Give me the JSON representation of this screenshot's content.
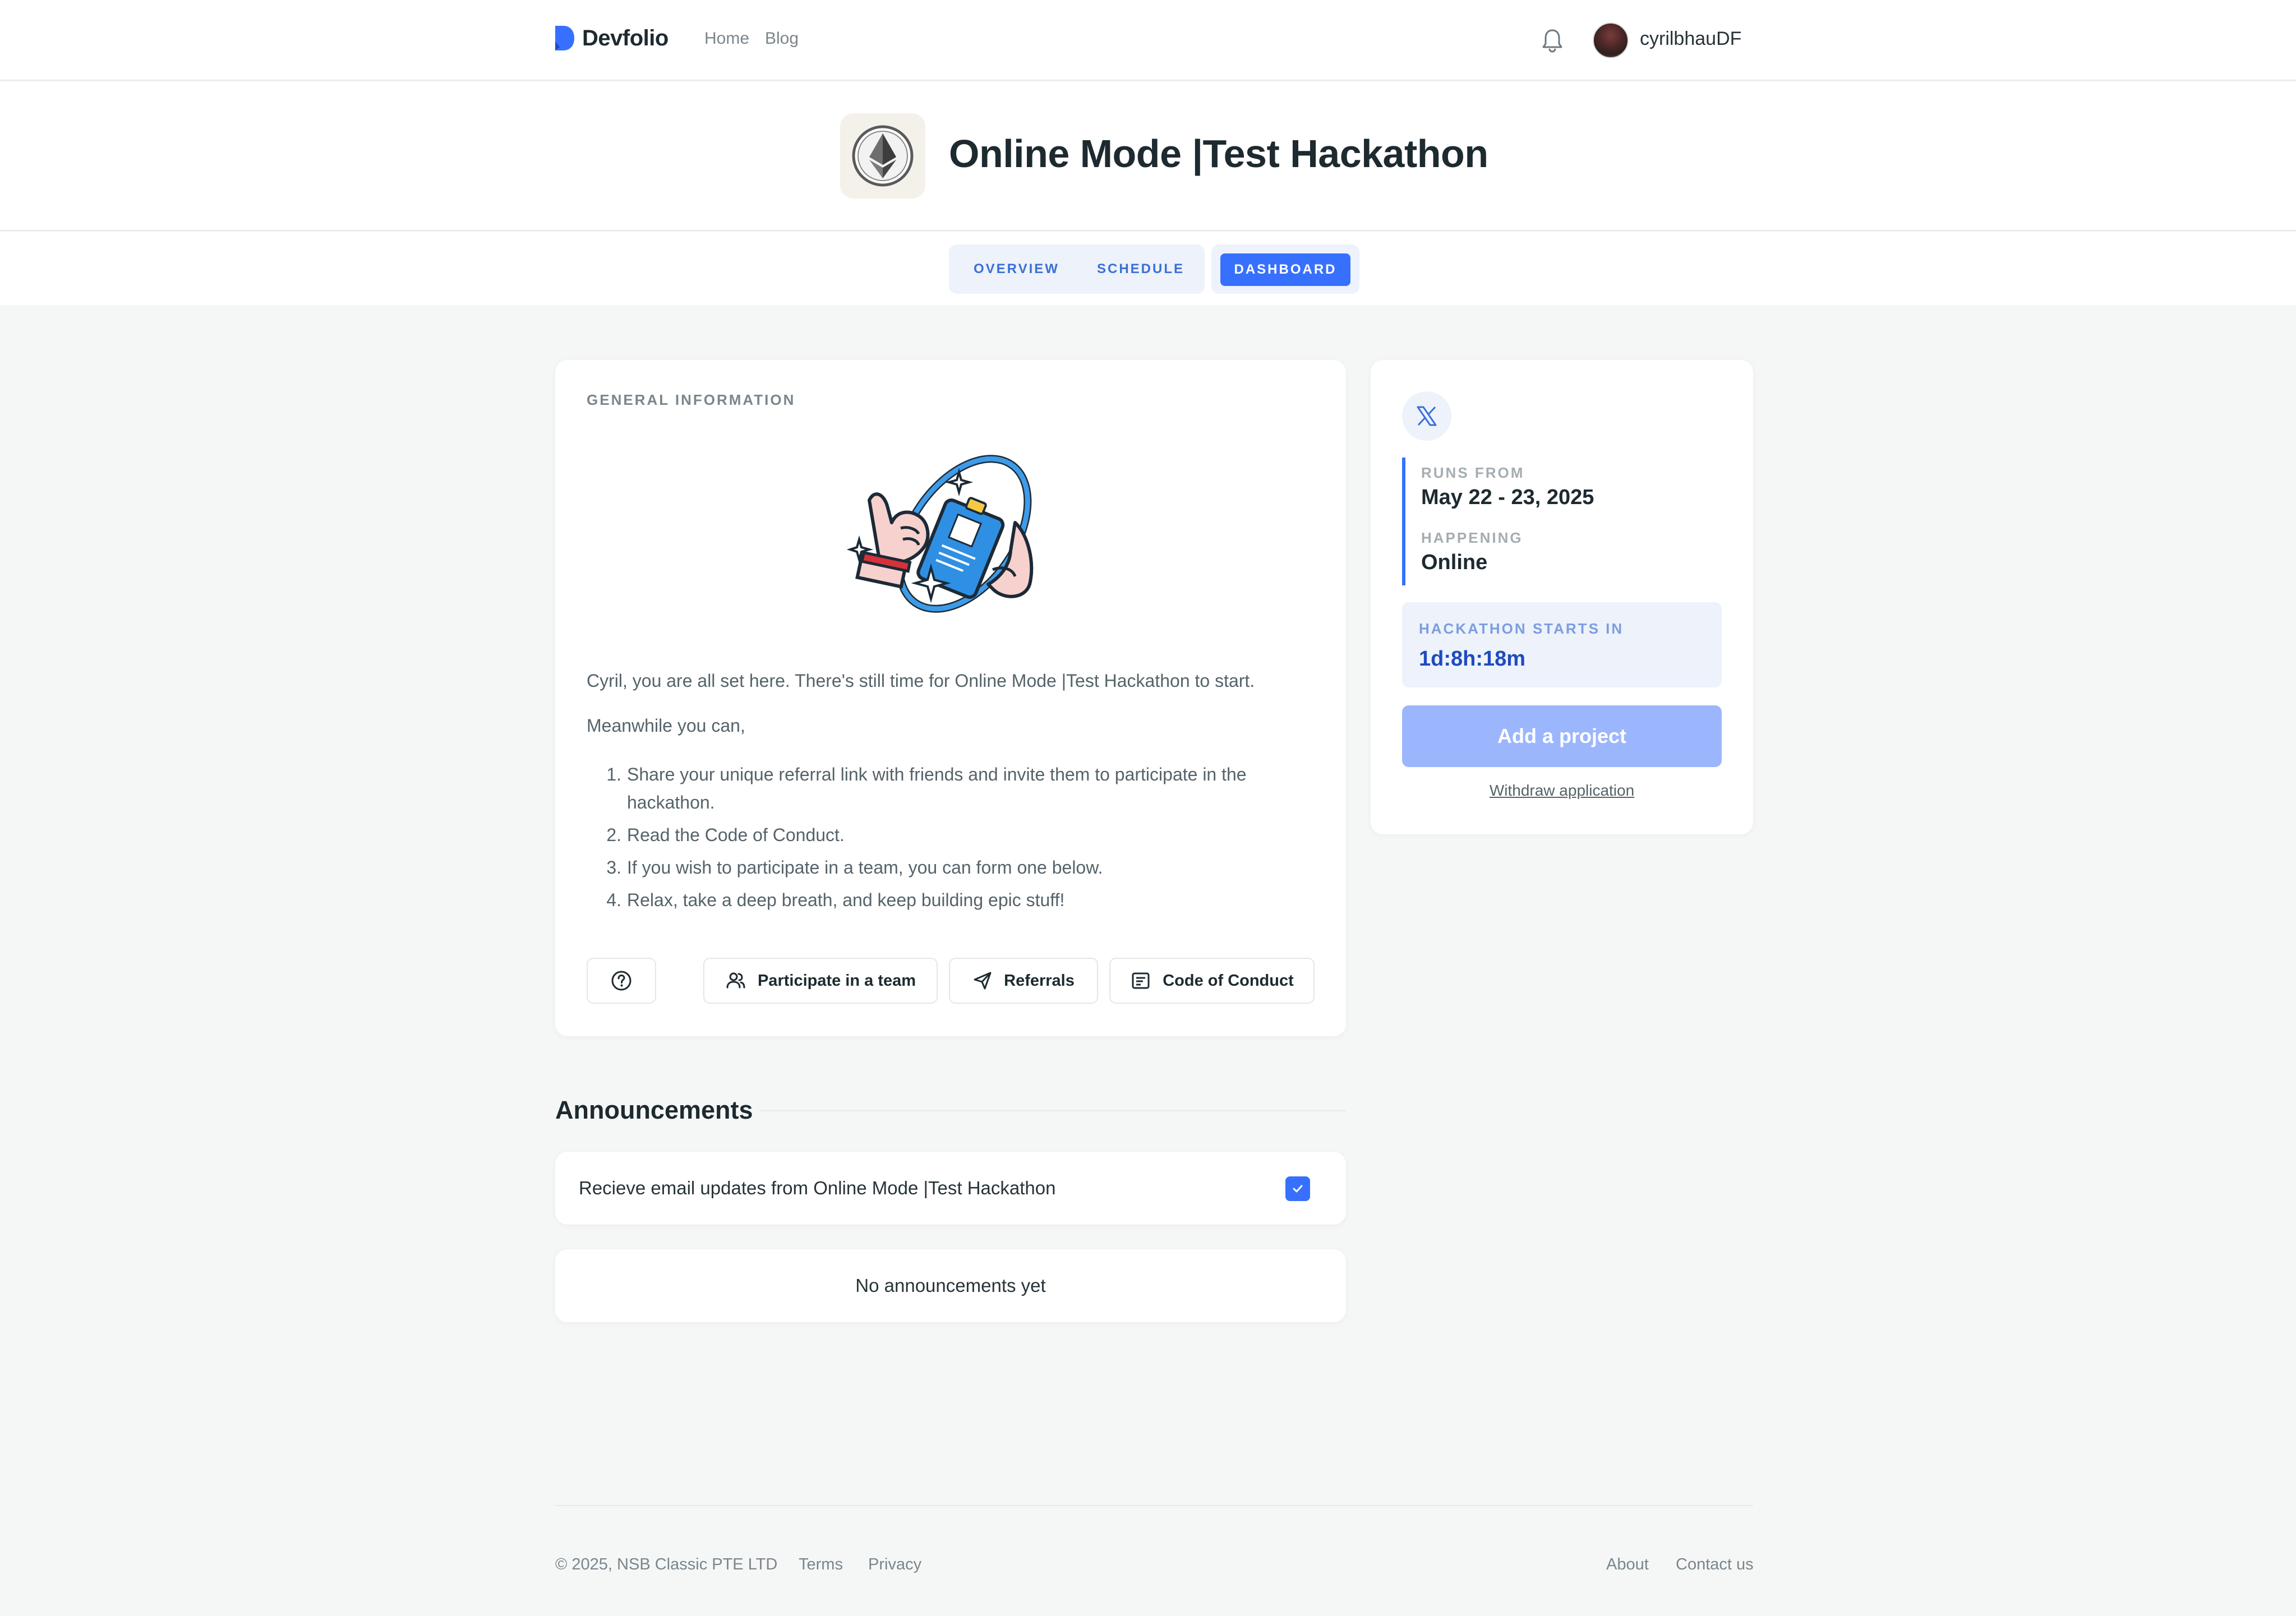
{
  "header": {
    "brand": "Devfolio",
    "nav": [
      "Home",
      "Blog"
    ],
    "username": "cyrilbhauDF"
  },
  "hackathon": {
    "title": "Online Mode |Test Hackathon",
    "logo_icon": "ethereum-icon"
  },
  "tabs": {
    "overview": "OVERVIEW",
    "schedule": "SCHEDULE",
    "dashboard": "DASHBOARD",
    "active": "DASHBOARD"
  },
  "general": {
    "section_label": "GENERAL INFORMATION",
    "intro": "Cyril, you are all set here. There's still time for Online Mode |Test Hackathon to start.",
    "meanwhile": "Meanwhile you can,",
    "steps": [
      {
        "num": "1.",
        "text": "Share your unique referral link with friends and invite them to participate in the hackathon."
      },
      {
        "num": "2.",
        "text": "Read the Code of Conduct."
      },
      {
        "num": "3.",
        "text": "If you wish to participate in a team, you can form one below."
      },
      {
        "num": "4.",
        "text": "Relax, take a deep breath, and keep building epic stuff!"
      }
    ],
    "buttons": {
      "team": "Participate in a team",
      "referrals": "Referrals",
      "coc": "Code of Conduct"
    }
  },
  "sidebar": {
    "social_icon": "x-twitter-icon",
    "runs_from_label": "RUNS FROM",
    "runs_from_value": "May 22 - 23, 2025",
    "happening_label": "HAPPENING",
    "happening_value": "Online",
    "starts_label": "HACKATHON STARTS IN",
    "starts_value": "1d:8h:18m",
    "add_project": "Add a project",
    "withdraw": "Withdraw application"
  },
  "announcements": {
    "title": "Announcements",
    "email_updates": "Recieve email updates from Online Mode |Test Hackathon",
    "email_checked": true,
    "empty": "No announcements yet"
  },
  "footer": {
    "copyright": "© 2025, NSB Classic PTE LTD",
    "terms": "Terms",
    "privacy": "Privacy",
    "about": "About",
    "contact": "Contact us"
  },
  "colors": {
    "accent": "#3770ff",
    "accent_light": "#9cb6fd",
    "background": "#f5f7f7"
  }
}
